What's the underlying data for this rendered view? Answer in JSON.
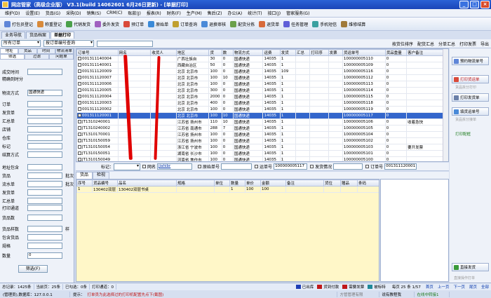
{
  "window": {
    "title": "网店管家（高级企业版） V3.1(build 14062601  6月26日更新) - [单据打印]",
    "min": "_",
    "max": "□",
    "close": "×"
  },
  "menu": [
    "维护(D)",
    "设置(E)",
    "货品(G)",
    "采购(D)",
    "销售(S)",
    "CRM(C)",
    "账款(J)",
    "报表(R)",
    "财务(F)",
    "生产(M)",
    "售后(Z)",
    "办公(A)",
    "统计(T)",
    "接口(J)",
    "管家服务(G)"
  ],
  "toolbar": [
    "打包员登记",
    "称重登记",
    "代销发货",
    "委外发货",
    "预订单",
    "原始单",
    "订单查询",
    "退换审核",
    "配货分拣",
    "退货单",
    "任务管理",
    "手机短信",
    "维修结算"
  ],
  "doc_tabs": [
    "业务导航",
    "货品档案",
    "单据打印"
  ],
  "filter": {
    "scope": "所有订单",
    "print_mode": "按订单编号查询",
    "right_buttons": [
      "按货位排序",
      "配货汇总",
      "分单汇总",
      "打印发票",
      "导出"
    ]
  },
  "left_panel": {
    "tabs_row1": [
      "地址",
      "货品",
      "时间",
      "物流清单"
    ],
    "tabs_row2": [
      "筛选",
      "过滤",
      "问题单"
    ],
    "fields": [
      {
        "label": "成交时间",
        "value": ""
      },
      {
        "label": "精确到时分",
        "value": ""
      },
      {
        "label": "物流方式",
        "value": "国通快递"
      },
      {
        "label": "订单",
        "value": ""
      },
      {
        "label": "发货单",
        "value": ""
      },
      {
        "label": "汇总单",
        "value": ""
      },
      {
        "label": "店铺",
        "value": ""
      },
      {
        "label": "仓库",
        "value": ""
      },
      {
        "label": "标记",
        "value": ""
      },
      {
        "label": "结算方式",
        "value": ""
      },
      {
        "label": "地址包含",
        "value": ""
      },
      {
        "label": "货品",
        "value": ""
      },
      {
        "label": "流水单",
        "value": ""
      },
      {
        "label": "发货单",
        "value": ""
      },
      {
        "label": "汇总单",
        "value": ""
      },
      {
        "label": "打印通道",
        "value": ""
      },
      {
        "label": "货品数",
        "value": ""
      },
      {
        "label": "货品样数",
        "value": ""
      },
      {
        "label": "包含货品",
        "value": ""
      },
      {
        "label": "规格",
        "value": ""
      },
      {
        "label": "数量",
        "value": "0"
      }
    ],
    "batch_label": "批次",
    "sample_label": "样",
    "filter_button": "筛选(F)"
  },
  "grid": {
    "columns": [
      "订单号",
      "网名",
      "收货人",
      "地区",
      "货",
      "数",
      "物流方式",
      "运费",
      "发货",
      "汇总",
      "打印序",
      "发票",
      "货运单号",
      "货品重量",
      "客户备注"
    ],
    "rows": [
      [
        "001311140004",
        "",
        "",
        "广西壮族自",
        "30",
        "0",
        "国通快递",
        "14035",
        "1",
        "",
        "",
        "",
        "100000005110",
        "0",
        ""
      ],
      [
        "001311140001",
        "",
        "",
        "西藏自治区",
        "50",
        "0",
        "国通快递",
        "14035",
        "1",
        "",
        "",
        "",
        "100000005109",
        "0",
        ""
      ],
      [
        "001311120009",
        "",
        "",
        "北京 北京市",
        "100",
        "0",
        "国通快递",
        "14035",
        "109",
        "",
        "",
        "",
        "100000005116",
        "0",
        ""
      ],
      [
        "001311120007",
        "",
        "",
        "北京 北京市",
        "100",
        "10",
        "国通快递",
        "14035",
        "1",
        "",
        "",
        "",
        "100000005112",
        "0",
        ""
      ],
      [
        "001311120006",
        "",
        "",
        "北京 北京市",
        "100",
        "0",
        "国通快递",
        "14035",
        "1",
        "",
        "",
        "",
        "100000005113",
        "0",
        ""
      ],
      [
        "001311120005",
        "",
        "",
        "北京 北京市",
        "300",
        "0",
        "国通快递",
        "14035",
        "1",
        "",
        "",
        "",
        "100000005114",
        "0",
        ""
      ],
      [
        "001311120004",
        "",
        "",
        "北京 北京市",
        "2000",
        "0",
        "国通快递",
        "14035",
        "1",
        "",
        "",
        "",
        "100000005115",
        "0",
        ""
      ],
      [
        "001311120003",
        "",
        "",
        "北京 北京市",
        "400",
        "0",
        "国通快递",
        "14035",
        "1",
        "",
        "",
        "",
        "100000005118",
        "0",
        ""
      ],
      [
        "001311120002",
        "",
        "",
        "北京 北京市",
        "100",
        "0",
        "国通快递",
        "14035",
        "1",
        "",
        "",
        "",
        "100000005119",
        "0",
        ""
      ],
      [
        "001311120001",
        "",
        "",
        "北京 北京市",
        "100",
        "10",
        "国通快递",
        "14035",
        "1",
        "",
        "",
        "",
        "100000005117",
        "0",
        ""
      ],
      [
        "JT1310240001",
        "",
        "",
        "江苏省 扬州市",
        "110",
        "10",
        "国通快递",
        "14035",
        "1",
        "",
        "",
        "",
        "100000005106",
        "0",
        "收着急快"
      ],
      [
        "JT1310240002",
        "",
        "",
        "江苏省 南通市",
        "288",
        "7",
        "国通快递",
        "14035",
        "1",
        "",
        "",
        "",
        "100000005105",
        "0",
        ""
      ],
      [
        "JT1310170001",
        "",
        "",
        "江苏省 扬州市",
        "100",
        "0",
        "国通快递",
        "14035",
        "1",
        "",
        "",
        "",
        "100000005104",
        "0",
        ""
      ],
      [
        "JT1310150059",
        "",
        "",
        "江苏省 扬州市",
        "100",
        "0",
        "国通快递",
        "14035",
        "1",
        "",
        "",
        "",
        "100000005102",
        "0",
        ""
      ],
      [
        "JT1310150054",
        "",
        "",
        "浙江省 宁波市",
        "100",
        "0",
        "国通快递",
        "14035",
        "1",
        "",
        "",
        "",
        "100000005103",
        "0",
        "要开发票"
      ],
      [
        "JT1310150051",
        "",
        "",
        "湖南省 长沙市",
        "100",
        "0",
        "国通快递",
        "14035",
        "1",
        "",
        "",
        "",
        "100000005101",
        "0",
        ""
      ],
      [
        "JT1310150049",
        "",
        "",
        "河南省 焦作市",
        "100",
        "0",
        "国通快递",
        "14035",
        "1",
        "",
        "",
        "",
        "100000005100",
        "0",
        ""
      ]
    ],
    "selected_index": 9
  },
  "right_panel": {
    "buttons": [
      "预约物流单号",
      "打印货运单",
      "打印发货单",
      "填货运单号",
      "直接发货"
    ],
    "notes": [
      "货品拆分打印",
      "货品拆分接单",
      "打印配框",
      "直接操作打单"
    ]
  },
  "info": {
    "mark_label": "标记：",
    "net_label": "网名",
    "net_value": "jiahibr",
    "original_label": "原始单号",
    "tracking_label": "运单号",
    "tracking_value": "100000005117",
    "ship_status_label": "发货情况",
    "order_label": "订单号",
    "order_value": "001311120001"
  },
  "sub_tabs": [
    "货品",
    "检视"
  ],
  "detail": {
    "columns": [
      "序号",
      "货品编号",
      "品名",
      "规格",
      "单位",
      "数量",
      "单价",
      "金额",
      "备注",
      "货位",
      "赠品",
      "条码"
    ],
    "rows": [
      [
        "1",
        "130402双层",
        "130402双层书桌",
        "",
        "",
        "1",
        "100",
        "100",
        "",
        "",
        "",
        ""
      ]
    ]
  },
  "status": {
    "total": "总记录：1425条",
    "page": "当前页：25条",
    "selected": "已勾选：0条",
    "print_channel": "打印通道：0",
    "legends": [
      {
        "label": "已出库",
        "color": "#1f3fb5"
      },
      {
        "label": "货到付款",
        "color": "#c01818"
      },
      {
        "label": "需要发票",
        "color": "#c01818"
      },
      {
        "label": "被标特",
        "color": "#1f8a9a"
      }
    ],
    "page_info": "每页 25 条  1/57",
    "nav": [
      "首页",
      "上一页",
      "下一页",
      "尾页",
      "全部"
    ]
  },
  "bottom": {
    "user": "(管理员),数据库：127.0.0.1",
    "tips_label": "提示：",
    "tip": "打单员为此选择过的打印机配置先点下(截图)",
    "company": "方管管理有限",
    "manual": "说有教程我",
    "chat": "在线中转接1"
  }
}
